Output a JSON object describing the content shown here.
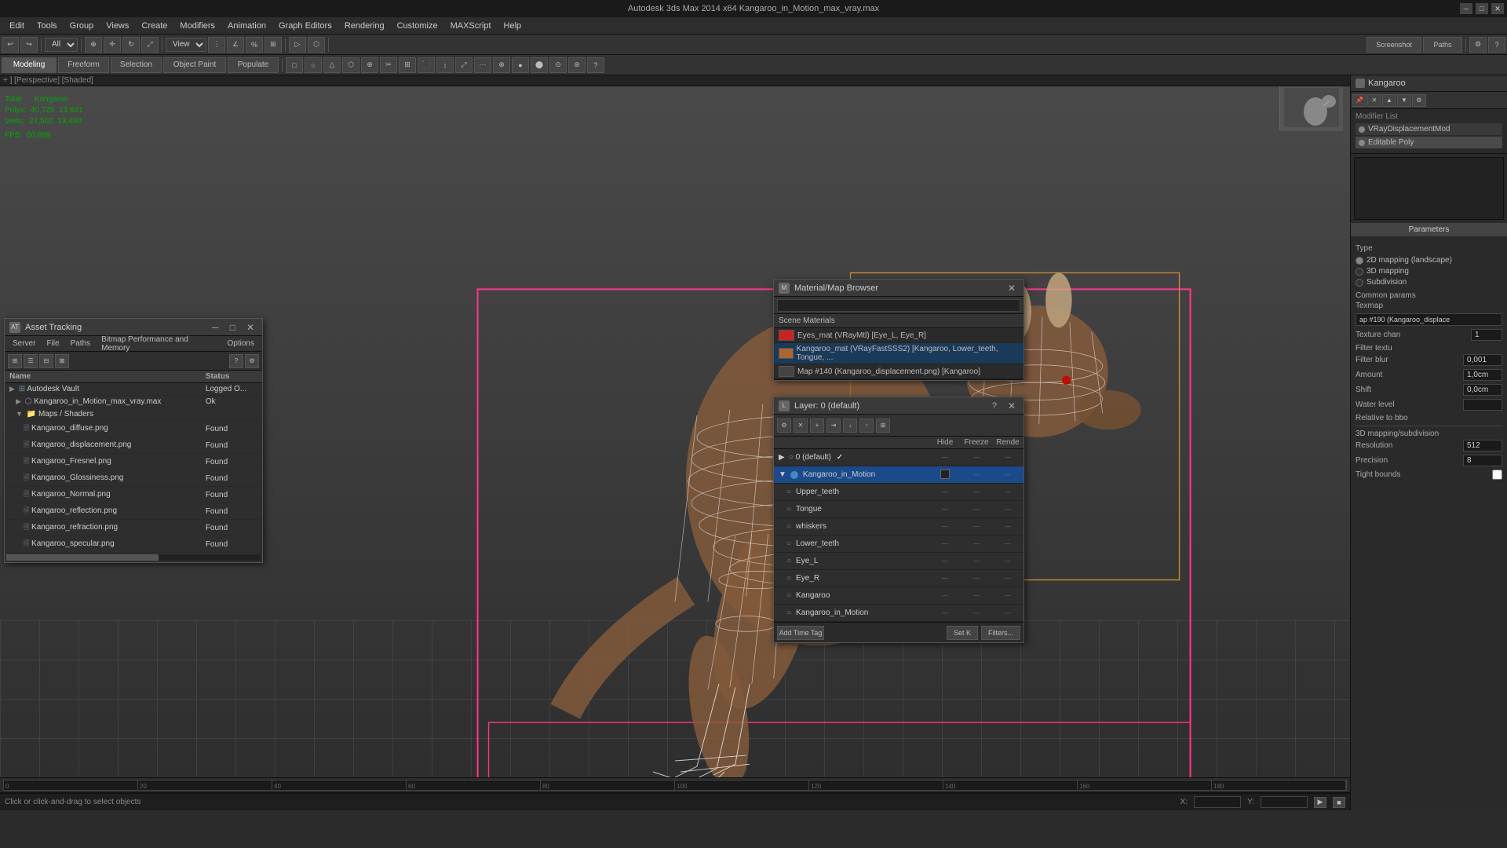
{
  "titlebar": {
    "title": "Autodesk 3ds Max 2014 x64    Kangaroo_in_Motion_max_vray.max"
  },
  "menu": {
    "items": [
      "Edit",
      "Tools",
      "Group",
      "Views",
      "Create",
      "Modifiers",
      "Animation",
      "Graph Editors",
      "Rendering",
      "Customize",
      "MAXScript",
      "Help"
    ]
  },
  "toolbar1": {
    "dropdown1": "All",
    "dropdown2": "View",
    "labels": [
      "Screenshot",
      "Paths"
    ]
  },
  "toolbar2": {
    "tabs": [
      "Modeling",
      "Freeform",
      "Selection",
      "Object Paint",
      "Populate"
    ]
  },
  "viewport": {
    "header": "+ ] [Perspective] [Shaded]",
    "stats": {
      "total_label": "Total",
      "kangaroo_label": "Kangaroo",
      "polys_label": "Polys:",
      "polys_total": "40,725",
      "polys_sel": "13,641",
      "verts_label": "Verts:",
      "verts_total": "27,502",
      "verts_sel": "13,480",
      "fps_label": "FPS:",
      "fps_val": "60,869"
    }
  },
  "right_panel": {
    "title": "Kangaroo",
    "modifier_list_label": "Modifier List",
    "modifiers": [
      {
        "name": "VRayDisplacementMod"
      },
      {
        "name": "Editable Poly"
      }
    ],
    "params": {
      "title": "Parameters",
      "type_label": "Type",
      "type_2d": "2D mapping (landscape)",
      "type_3d": "3D mapping",
      "type_subdivision": "Subdivision",
      "common_params": "Common params",
      "texmap_label": "Texmap",
      "texmap_val": "ap #190 (Kangaroo_displace",
      "texture_chan_label": "Texture chan",
      "texture_chan_val": "1",
      "filter_tex_label": "Filter textu",
      "filter_blur_label": "Filter blur",
      "filter_blur_val": "0,001",
      "amount_label": "Amount",
      "amount_val": "1,0cm",
      "shift_label": "Shift",
      "shift_val": "0,0cm",
      "water_level_label": "Water level",
      "water_level_val": "",
      "relative_label": "Relative to bbo",
      "resolution_label": "Resolution",
      "resolution_val": "512",
      "precision_label": "Precision",
      "precision_val": "8",
      "tight_bounds_label": "Tight bounds",
      "subdivision_label": "3D mapping/subdivision"
    }
  },
  "asset_tracking": {
    "title": "Asset Tracking",
    "menu": [
      "Server",
      "File",
      "Paths",
      "Bitmap Performance and Memory",
      "Options"
    ],
    "columns": [
      "Name",
      "Status"
    ],
    "rows": [
      {
        "indent": 0,
        "name": "Autodesk Vault",
        "status": "Logged O...",
        "type": "vault"
      },
      {
        "indent": 1,
        "name": "Kangaroo_in_Motion_max_vray.max",
        "status": "Ok",
        "type": "file"
      },
      {
        "indent": 2,
        "name": "Maps / Shaders",
        "status": "",
        "type": "folder"
      },
      {
        "indent": 3,
        "name": "Kangaroo_diffuse.png",
        "status": "Found",
        "type": "map"
      },
      {
        "indent": 3,
        "name": "Kangaroo_displacement.png",
        "status": "Found",
        "type": "map"
      },
      {
        "indent": 3,
        "name": "Kangaroo_Fresnel.png",
        "status": "Found",
        "type": "map"
      },
      {
        "indent": 3,
        "name": "Kangaroo_Glossiness.png",
        "status": "Found",
        "type": "map"
      },
      {
        "indent": 3,
        "name": "Kangaroo_Normal.png",
        "status": "Found",
        "type": "map"
      },
      {
        "indent": 3,
        "name": "Kangaroo_reflection.png",
        "status": "Found",
        "type": "map"
      },
      {
        "indent": 3,
        "name": "Kangaroo_refraction.png",
        "status": "Found",
        "type": "map"
      },
      {
        "indent": 3,
        "name": "Kangaroo_specular.png",
        "status": "Found",
        "type": "map"
      }
    ]
  },
  "material_browser": {
    "title": "Material/Map Browser",
    "section": "Scene Materials",
    "items": [
      {
        "name": "Eyes_mat (VRayMtl) [Eye_L, Eye_R]",
        "color": "#cc2222",
        "selected": false
      },
      {
        "name": "Kangaroo_mat (VRayFastSSS2) [Kangaroo, Lower_teeth, Tongue, ...",
        "color": "#aa6633",
        "selected": true
      },
      {
        "name": "Map #140 (Kangaroo_displacement.png) [Kangaroo]",
        "color": "#444",
        "selected": false
      }
    ]
  },
  "layer_manager": {
    "title": "Layer: 0 (default)",
    "columns": [
      "",
      "Hide",
      "Freeze",
      "Rende"
    ],
    "layers": [
      {
        "indent": 0,
        "name": "0 (default)",
        "active": true,
        "hide": false,
        "freeze": false,
        "render": true,
        "type": "default"
      },
      {
        "indent": 0,
        "name": "Kangaroo_in_Motion",
        "selected": true,
        "type": "blue"
      },
      {
        "indent": 1,
        "name": "Upper_teeth",
        "type": "normal"
      },
      {
        "indent": 1,
        "name": "Tongue",
        "type": "normal"
      },
      {
        "indent": 1,
        "name": "whiskers",
        "type": "normal"
      },
      {
        "indent": 1,
        "name": "Lower_teeth",
        "type": "normal"
      },
      {
        "indent": 1,
        "name": "Eye_L",
        "type": "normal"
      },
      {
        "indent": 1,
        "name": "Eye_R",
        "type": "normal"
      },
      {
        "indent": 1,
        "name": "Kangaroo",
        "type": "normal"
      },
      {
        "indent": 1,
        "name": "Kangaroo_in_Motion",
        "type": "normal"
      }
    ]
  },
  "timeline": {
    "markers": [
      "0",
      "20",
      "40",
      "60",
      "80",
      "100",
      "120",
      "140",
      "160",
      "180"
    ]
  },
  "status_bar": {
    "coords_x": "X:",
    "coords_y": "Y:",
    "message": "Click or click-and-drag to select objects"
  }
}
